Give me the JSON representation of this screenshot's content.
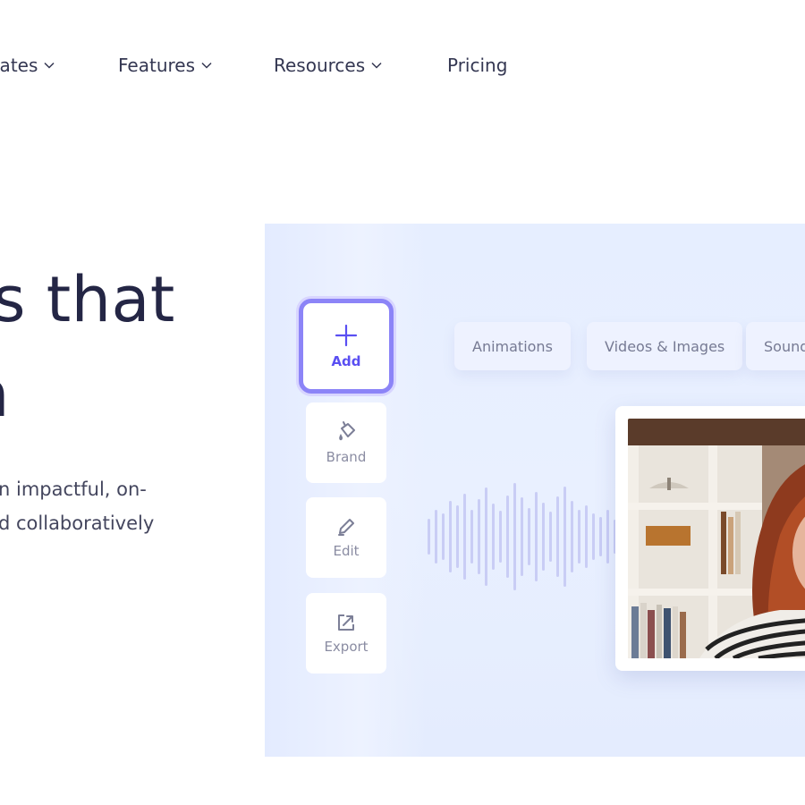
{
  "nav": {
    "items": [
      {
        "label": "lates",
        "has_dropdown": true
      },
      {
        "label": "Features",
        "has_dropdown": true
      },
      {
        "label": "Resources",
        "has_dropdown": true
      },
      {
        "label": "Pricing",
        "has_dropdown": false
      }
    ]
  },
  "hero": {
    "headline_line1": "s that",
    "headline_line2_fragment": "n",
    "subtext_line1": "n impactful, on-",
    "subtext_line2": "d collaboratively"
  },
  "editor": {
    "tools": [
      {
        "label": "Add",
        "icon": "plus-icon"
      },
      {
        "label": "Brand",
        "icon": "paint-bucket-icon"
      },
      {
        "label": "Edit",
        "icon": "pencil-icon"
      },
      {
        "label": "Export",
        "icon": "export-icon"
      }
    ],
    "chips": [
      "Animations",
      "Videos & Images",
      "Sound"
    ]
  },
  "colors": {
    "accent": "#5a4ff2",
    "accent_border": "#8c84f7",
    "panel_bg": "#e6eeff",
    "text_dark": "#242645"
  }
}
